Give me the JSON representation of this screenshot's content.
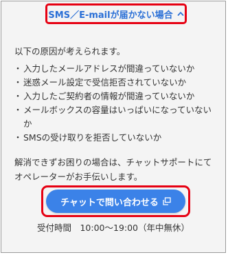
{
  "header": {
    "title": "SMS／E-mailが届かない場合",
    "toggle_icon": "chevron-up-icon",
    "highlight_color": "#e60012",
    "title_color": "#2a6fd6"
  },
  "intro": "以下の原因が考えられます。",
  "reasons": [
    {
      "bullet": "・",
      "text": "入力したメールアドレスが間違っていないか"
    },
    {
      "bullet": "・",
      "text": "迷惑メール設定で受信拒否されていないか"
    },
    {
      "bullet": "・",
      "text": "入力したご契約者の情報が間違っていないか"
    },
    {
      "bullet": "・",
      "text": "メールボックスの容量はいっぱいになっていないか"
    },
    {
      "bullet": "・",
      "text": "SMSの受け取りを拒否していないか"
    }
  ],
  "note": {
    "line1": "解消できずお困りの場合は、チャットサポートにて",
    "line2": "オペレーターがお手伝いします。"
  },
  "chat": {
    "label": "チャットで問い合わせる",
    "icon": "external-window-icon",
    "button_color": "#3b82e8"
  },
  "hours": "受付時間　10:00～19:00（年中無休）"
}
